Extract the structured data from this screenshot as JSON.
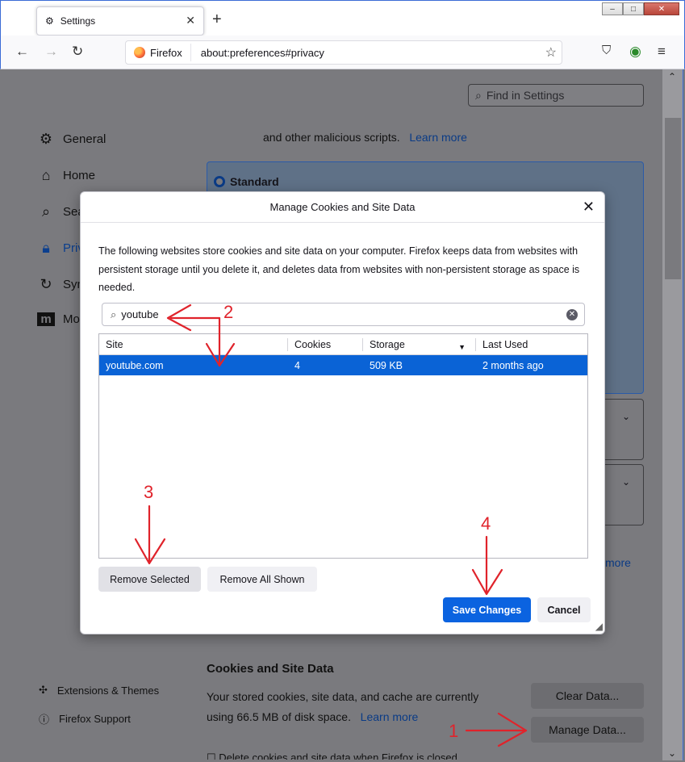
{
  "browser": {
    "tab_title": "Settings",
    "identity_label": "Firefox",
    "url": "about:preferences#privacy"
  },
  "settings": {
    "find_placeholder": "Find in Settings",
    "sidebar": [
      {
        "label": "General",
        "icon": "gear-icon"
      },
      {
        "label": "Home",
        "icon": "home-icon"
      },
      {
        "label": "Sea",
        "icon": "search-icon"
      },
      {
        "label": "Priv",
        "icon": "lock-icon"
      },
      {
        "label": "Syn",
        "icon": "sync-icon"
      },
      {
        "label": "Mo",
        "icon": "mozilla-icon"
      }
    ],
    "footer_links": [
      {
        "label": "Extensions & Themes",
        "icon": "puzzle-icon"
      },
      {
        "label": "Firefox Support",
        "icon": "help-icon"
      }
    ],
    "scripts_text": "and other malicious scripts.",
    "learn_more": "Learn more",
    "standard_label": "Standard",
    "more_fragment": "more",
    "cookies_heading": "Cookies and Site Data",
    "cookies_desc_line1": "Your stored cookies, site data, and cache are currently",
    "cookies_desc_line2": "using 66.5 MB of disk space.",
    "clear_data_button": "Clear Data...",
    "manage_data_button": "Manage Data...",
    "delete_checkbox_label": "Delete cookies and site data when Firefox is closed"
  },
  "dialog": {
    "title": "Manage Cookies and Site Data",
    "description": "The following websites store cookies and site data on your computer. Firefox keeps data from websites with persistent storage until you delete it, and deletes data from websites with non-persistent storage as space is needed.",
    "search_value": "youtube",
    "columns": [
      "Site",
      "Cookies",
      "Storage",
      "Last Used"
    ],
    "rows": [
      {
        "site": "youtube.com",
        "cookies": "4",
        "storage": "509 KB",
        "last_used": "2 months ago"
      }
    ],
    "remove_selected": "Remove Selected",
    "remove_all_shown": "Remove All Shown",
    "save_changes": "Save Changes",
    "cancel": "Cancel"
  },
  "annotations": [
    "1",
    "2",
    "3",
    "4"
  ],
  "colors": {
    "annotation": "#e0232b",
    "accent": "#0b63e0",
    "selection": "#0a63d6"
  }
}
